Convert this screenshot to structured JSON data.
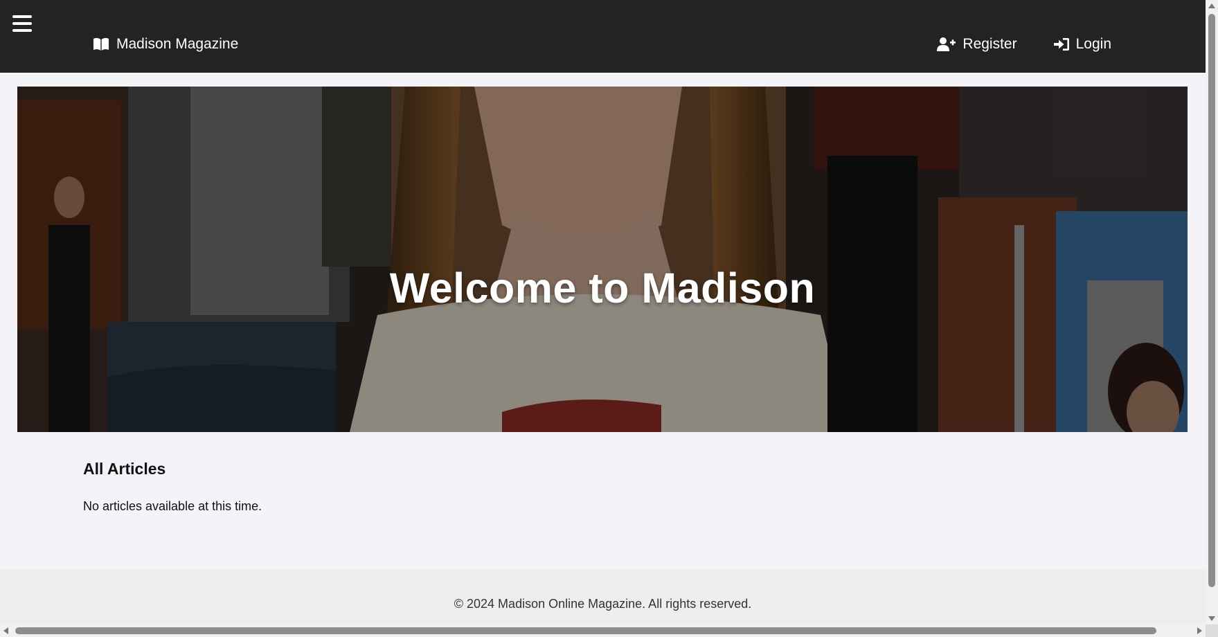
{
  "navbar": {
    "brand_label": "Madison Magazine",
    "register_label": "Register",
    "login_label": "Login",
    "background_color": "#232323",
    "icons": {
      "menu": "hamburger-menu-icon",
      "brand": "open-book-icon",
      "register": "user-plus-icon",
      "login": "sign-in-icon"
    }
  },
  "hero": {
    "title": "Welcome to Madison"
  },
  "articles": {
    "heading": "All Articles",
    "empty_message": "No articles available at this time."
  },
  "footer": {
    "copyright": "© 2024 Madison Online Magazine. All rights reserved."
  },
  "colors": {
    "page_background": "#f4f4f8",
    "footer_background": "#eeeeee"
  }
}
